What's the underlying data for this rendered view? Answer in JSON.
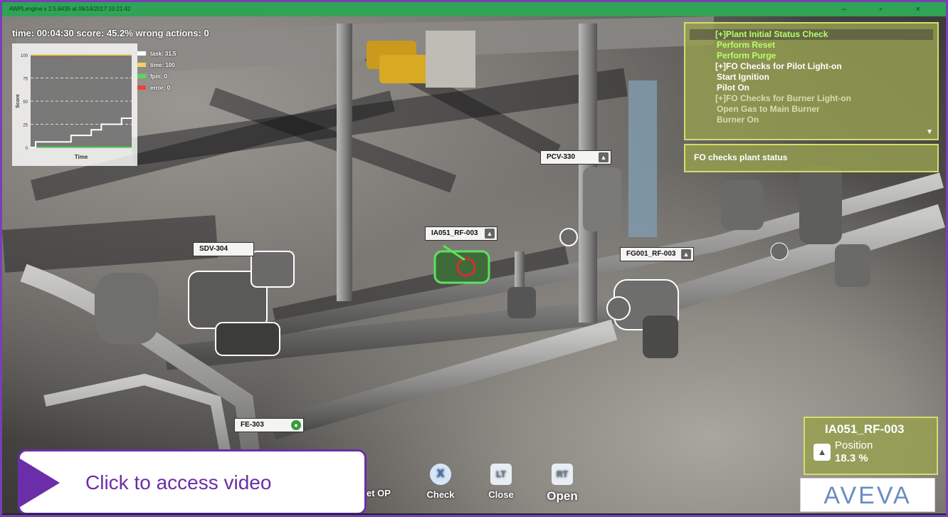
{
  "window": {
    "title": "AWPLengine v 2.5.6435 at 06/14/2017 10:21:42",
    "controls": "– ▫ ×"
  },
  "hud": {
    "stats_text": "time: 00:04:30 score: 45.2% wrong actions: 0"
  },
  "chart_data": {
    "type": "line",
    "xlabel": "Time",
    "ylabel": "Score",
    "ylim": [
      0,
      100
    ],
    "yticks": [
      "0",
      "25",
      "50",
      "75",
      "100"
    ],
    "grid": true,
    "series": [
      {
        "name": "task: 31.5",
        "color": "#ffffff",
        "x": [
          0,
          5,
          5,
          40,
          40,
          60,
          60,
          70,
          70,
          90,
          90,
          100
        ],
        "y": [
          0,
          0,
          6,
          6,
          13,
          13,
          19,
          19,
          25,
          25,
          31.5,
          31.5
        ]
      },
      {
        "name": "time: 100",
        "color": "#f4d35e",
        "x": [
          0,
          100
        ],
        "y": [
          100,
          100
        ]
      },
      {
        "name": "fpm: 0",
        "color": "#5cd65c",
        "x": [
          0,
          100
        ],
        "y": [
          0,
          0
        ]
      },
      {
        "name": "error: 0",
        "color": "#e8453c",
        "x": [
          0,
          100
        ],
        "y": [
          0,
          0
        ]
      }
    ]
  },
  "procedure": {
    "items": [
      {
        "text": "[+]Plant Initial Status Check",
        "color": "#b8ff6a",
        "kind": "header",
        "highlight": true
      },
      {
        "text": "Perform Reset",
        "color": "#b8ff6a",
        "kind": "step"
      },
      {
        "text": "Perform Purge",
        "color": "#b8ff6a",
        "kind": "step"
      },
      {
        "text": "[+]FO Checks for Pilot Light-on",
        "color": "#ffffff",
        "kind": "header"
      },
      {
        "text": "Start Ignition",
        "color": "#ffffff",
        "kind": "step"
      },
      {
        "text": "Pilot On",
        "color": "#ffffff",
        "kind": "step"
      },
      {
        "text": "[+]FO Checks for Burner Light-on",
        "color": "#d8dcb0",
        "kind": "header"
      },
      {
        "text": "Open Gas to Main Burner",
        "color": "#d8dcb0",
        "kind": "step"
      },
      {
        "text": "Burner On",
        "color": "#d8dcb0",
        "kind": "step"
      }
    ],
    "scroll_glyph": "▼"
  },
  "status": {
    "text": "FO checks plant status"
  },
  "tags": {
    "pcv": "PCV-330",
    "ia051": "IA051_RF-003",
    "fg001": "FG001_RF-003",
    "sdv": "SDV-304",
    "fe": "FE-303"
  },
  "valve_info": {
    "name": "IA051_RF-003",
    "position_label": "Position",
    "position_value": "18.3 %"
  },
  "controls": {
    "partial_label": "et OP",
    "check": {
      "glyph": "X",
      "label": "Check"
    },
    "close": {
      "glyph": "LT",
      "label": "Close"
    },
    "open": {
      "glyph": "RT",
      "label": "Open"
    }
  },
  "video_callout": {
    "text": "Click to access video"
  },
  "logo": {
    "text": "AVEVA"
  },
  "colors": {
    "frame": "#7a3fb4",
    "panel": "#96a050",
    "panel_border": "#d7db6a",
    "callout": "#6a2fa8"
  }
}
